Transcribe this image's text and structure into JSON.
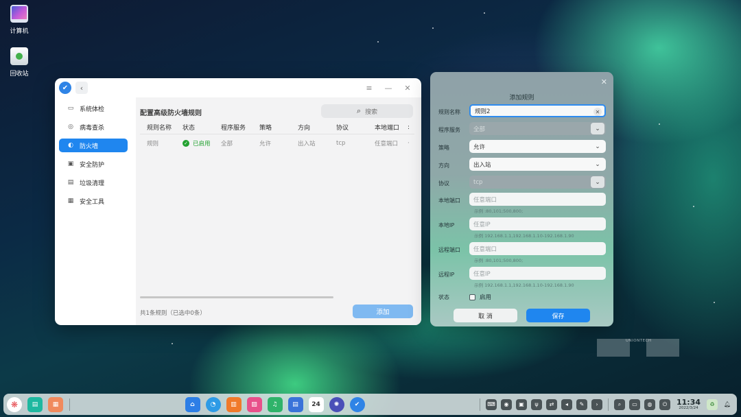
{
  "desktop": {
    "icons": [
      {
        "label": "计算机",
        "icon": "computer-icon"
      },
      {
        "label": "回收站",
        "icon": "trash-icon"
      }
    ],
    "watermark": "UNIONTECH"
  },
  "main_window": {
    "title_buttons": {
      "menu": "≡",
      "minimize": "—",
      "close": "✕"
    },
    "sidebar": [
      {
        "label": "系统体检",
        "icon": "monitor-icon"
      },
      {
        "label": "病毒查杀",
        "icon": "virus-scan-icon"
      },
      {
        "label": "防火墙",
        "icon": "firewall-icon",
        "active": true
      },
      {
        "label": "安全防护",
        "icon": "shield-protect-icon"
      },
      {
        "label": "垃圾清理",
        "icon": "trash-clean-icon"
      },
      {
        "label": "安全工具",
        "icon": "toolbox-icon"
      }
    ],
    "page_title": "配置高级防火墙规则",
    "search_placeholder": "搜索",
    "table": {
      "columns": [
        "规则名称",
        "状态",
        "程序服务",
        "策略",
        "方向",
        "协议",
        "本地端口",
        ":"
      ],
      "rows": [
        {
          "name": "规则",
          "status": "已启用",
          "service": "全部",
          "policy": "允许",
          "direction": "出入站",
          "protocol": "tcp",
          "local_port": "任意端口",
          "more": "·"
        }
      ]
    },
    "footer_note": "共1条规则（已选中0条）",
    "add_label": "添加"
  },
  "dialog": {
    "title": "添加规则",
    "fields": {
      "rule_name": {
        "label": "规则名称",
        "value": "规则2"
      },
      "service": {
        "label": "程序服务",
        "value": "全部"
      },
      "policy": {
        "label": "策略",
        "value": "允许"
      },
      "direction": {
        "label": "方向",
        "value": "出入站"
      },
      "protocol": {
        "label": "协议",
        "value": "tcp"
      },
      "local_port": {
        "label": "本地端口",
        "placeholder": "任意端口",
        "hint": "示例 :80,101;500,800;"
      },
      "local_ip": {
        "label": "本地IP",
        "placeholder": "任意IP",
        "hint": "示例 192.168.1.1,192.168.1.10-192.168.1.90"
      },
      "remote_port": {
        "label": "远程端口",
        "placeholder": "任意端口",
        "hint": "示例 :80,101;500,800;"
      },
      "remote_ip": {
        "label": "远程IP",
        "placeholder": "任意IP",
        "hint": "示例 192.168.1.1,192.168.1.10-192.168.1.90"
      },
      "status": {
        "label": "状态",
        "checkbox_label": "启用",
        "checked": false
      }
    },
    "cancel_label": "取 消",
    "save_label": "保存"
  },
  "taskbar": {
    "calendar_day": "24",
    "time": "11:34",
    "date": "2022/3/24"
  }
}
